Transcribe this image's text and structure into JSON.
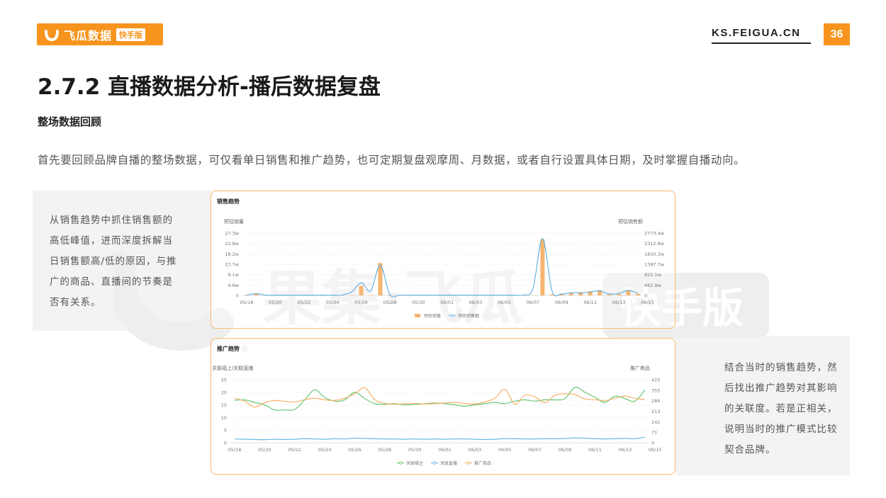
{
  "header": {
    "logo_text": "飞瓜数据",
    "logo_badge": "快手版",
    "site": "KS.FEIGUA.CN",
    "page_number": "36"
  },
  "title": "2.7.2 直播数据分析-播后数据复盘",
  "subtitle": "整场数据回顾",
  "description": "首先要回顾品牌自播的整场数据，可仅看单日销售和推广趋势，也可定期复盘观摩周、月数据，或者自行设置具体日期，及时掌握自播动向。",
  "notes": {
    "left": "从销售趋势中抓住销售额的高低峰值，进而深度拆解当日销售额高/低的原因，与推广的商品、直播间的节奏是否有关系。",
    "right": "结合当时的销售趋势，然后找出推广趋势对其影响的关联度。若是正相关，说明当时的推广模式比较契合品牌。"
  },
  "watermark": {
    "text": "果集·飞瓜",
    "badge": "快手版"
  },
  "colors": {
    "accent": "#f7941d",
    "bar": "#f5b571",
    "line_blue": "#5aaee0",
    "line_green": "#5cc26a",
    "line_orange": "#f5a95b"
  },
  "chart_data": [
    {
      "type": "bar",
      "title": "销售趋势",
      "left_axis_title": "预估销量",
      "right_axis_title": "预估销售额",
      "left_ticks": [
        "0",
        "4.6w",
        "9.1w",
        "13.7w",
        "18.2w",
        "22.8w",
        "27.3w"
      ],
      "right_ticks": [
        "0",
        "462.9w",
        "925.1w",
        "1387.7w",
        "1850.3w",
        "2312.8w",
        "2773.4w"
      ],
      "x_tick_labels": [
        "05/18",
        "05/20",
        "05/22",
        "05/24",
        "05/26",
        "05/28",
        "05/30",
        "06/01",
        "06/03",
        "06/05",
        "06/07",
        "06/09",
        "06/11",
        "06/13",
        "06/15"
      ],
      "ylim_left": [
        0,
        27.3
      ],
      "ylim_right": [
        0,
        2773.4
      ],
      "series": [
        {
          "name": "预估销量",
          "kind": "bar",
          "values": [
            0.3,
            0.9,
            0.1,
            0.1,
            0.1,
            0.1,
            0.1,
            0.1,
            0.1,
            0.1,
            0.1,
            0.1,
            4.2,
            0.1,
            14.2,
            0.1,
            0.1,
            0.1,
            0.1,
            0.1,
            0.1,
            0.1,
            0.1,
            0.1,
            0.1,
            0.1,
            0.1,
            0.1,
            0.1,
            0.1,
            0.1,
            24.6,
            0.5,
            0.8,
            1.2,
            1.4,
            1.8,
            2.3,
            0.4,
            0.6,
            2.4,
            0.7
          ]
        },
        {
          "name": "预估销售额",
          "kind": "line",
          "values": [
            5,
            80,
            10,
            10,
            10,
            10,
            10,
            10,
            10,
            10,
            20,
            150,
            560,
            200,
            1350,
            40,
            10,
            10,
            10,
            10,
            10,
            10,
            10,
            10,
            10,
            10,
            10,
            10,
            10,
            20,
            300,
            2540,
            200,
            60,
            120,
            110,
            150,
            200,
            60,
            90,
            220,
            90
          ]
        }
      ],
      "legend_position": "bottom"
    },
    {
      "type": "line",
      "title": "推广趋势",
      "left_axis_title": "关联福上/关联直播",
      "right_axis_title": "推广商品",
      "left_ticks": [
        "0",
        "5",
        "10",
        "15",
        "20",
        "25"
      ],
      "right_ticks": [
        "0",
        "71",
        "142",
        "213",
        "284",
        "355",
        "425"
      ],
      "x_tick_labels": [
        "05/18",
        "05/20",
        "05/22",
        "05/24",
        "05/26",
        "05/28",
        "05/30",
        "06/01",
        "06/03",
        "06/05",
        "06/07",
        "06/09",
        "06/11",
        "06/13",
        "06/15"
      ],
      "ylim_left": [
        0,
        25
      ],
      "ylim_right": [
        0,
        425
      ],
      "series": [
        {
          "name": "关联福主",
          "kind": "line",
          "values": [
            16.8,
            17,
            16,
            15,
            13,
            13,
            13.2,
            17,
            21,
            18,
            16.5,
            17,
            20,
            17.5,
            15.5,
            15.2,
            15.5,
            15,
            15.2,
            15.5,
            15.8,
            15.5,
            15,
            14.5,
            15,
            15.5,
            16,
            15.5,
            16.5,
            17,
            16.5,
            17,
            17,
            17.5,
            22,
            20,
            18,
            16,
            18.5,
            17.5,
            16.5,
            21
          ]
        },
        {
          "name": "关联直播",
          "kind": "line",
          "values": [
            1.5,
            1.4,
            1.3,
            1.2,
            1.4,
            1.3,
            1.4,
            1.6,
            1.5,
            1.4,
            1.6,
            1.5,
            1.8,
            1.7,
            1.6,
            1.5,
            1.5,
            1.4,
            1.5,
            1.4,
            1.5,
            1.4,
            1.5,
            1.5,
            1.4,
            1.3,
            1.4,
            1.6,
            1.6,
            1.5,
            1.5,
            1.6,
            1.6,
            1.7,
            1.9,
            1.8,
            1.6,
            1.5,
            1.6,
            1.7,
            1.6,
            2.2
          ]
        },
        {
          "name": "推广商品",
          "kind": "line",
          "values": [
            300,
            280,
            240,
            270,
            285,
            280,
            275,
            290,
            300,
            290,
            285,
            300,
            330,
            370,
            290,
            265,
            260,
            262,
            265,
            262,
            264,
            268,
            272,
            265,
            260,
            275,
            300,
            360,
            260,
            320,
            310,
            270,
            320,
            330,
            325,
            295,
            290,
            285,
            300,
            315,
            300,
            290
          ]
        }
      ],
      "legend_position": "bottom"
    }
  ]
}
